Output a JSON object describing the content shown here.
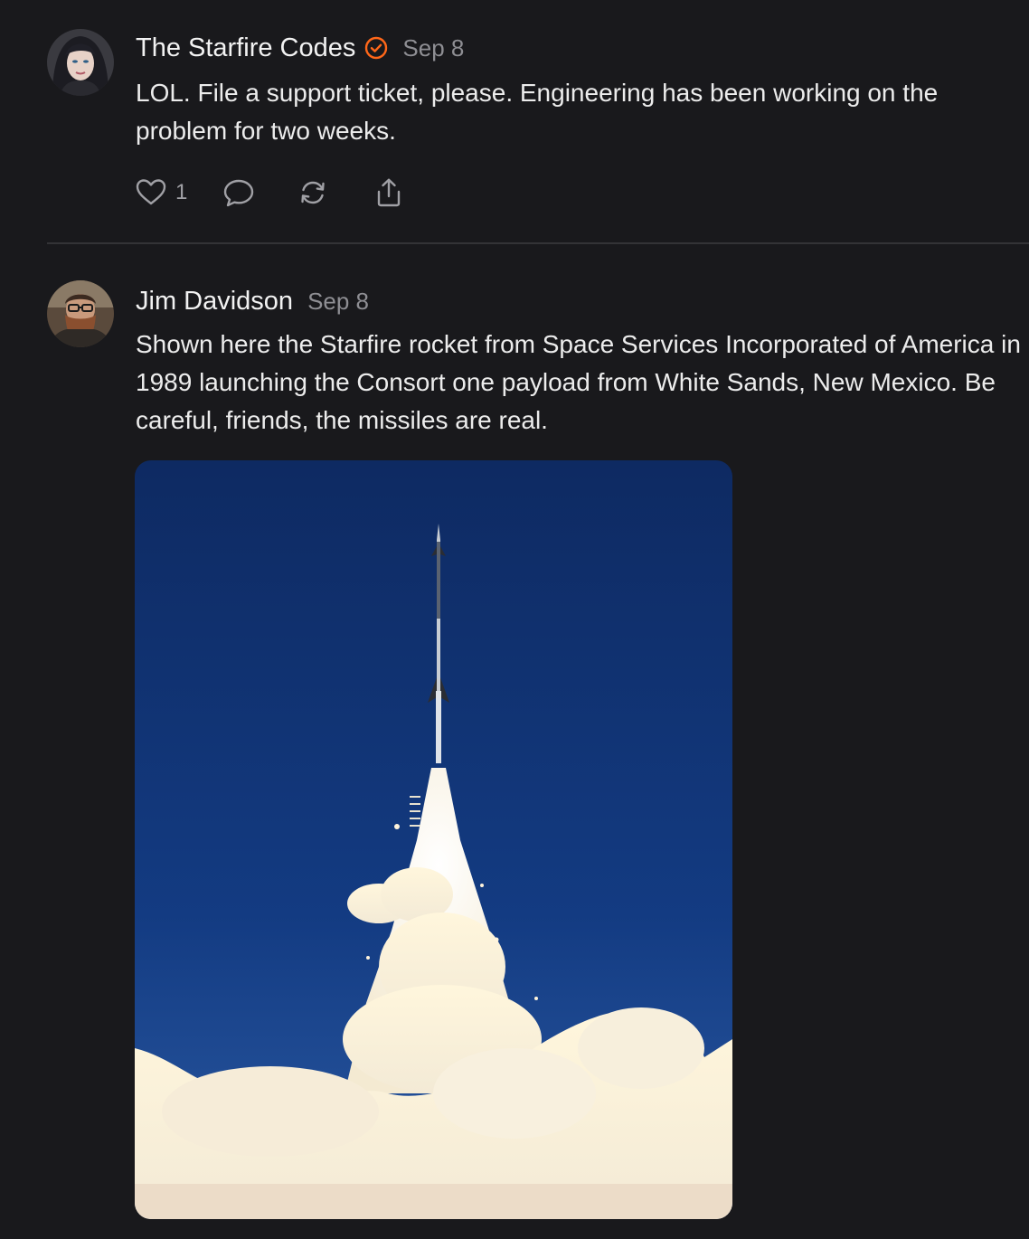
{
  "posts": [
    {
      "author": "The Starfire Codes",
      "verified": true,
      "date": "Sep 8",
      "text": "LOL. File a support ticket, please. Engineering has been working on the problem for two weeks.",
      "likes": "1",
      "icons": {
        "like": "heart-icon",
        "comment": "comment-bubble-icon",
        "restack": "restack-icon",
        "share": "share-icon",
        "verified": "verified-badge-icon"
      }
    },
    {
      "author": "Jim Davidson",
      "date": "Sep 8",
      "text": "Shown here the Starfire rocket from Space Services Incorporated of America in 1989 launching the Consort one payload from White Sands, New Mexico. Be careful, friends, the missiles are real."
    }
  ],
  "colors": {
    "background": "#19191c",
    "badge": "#ff6719",
    "muted": "#8e8e93",
    "sky": "#102f6a"
  }
}
